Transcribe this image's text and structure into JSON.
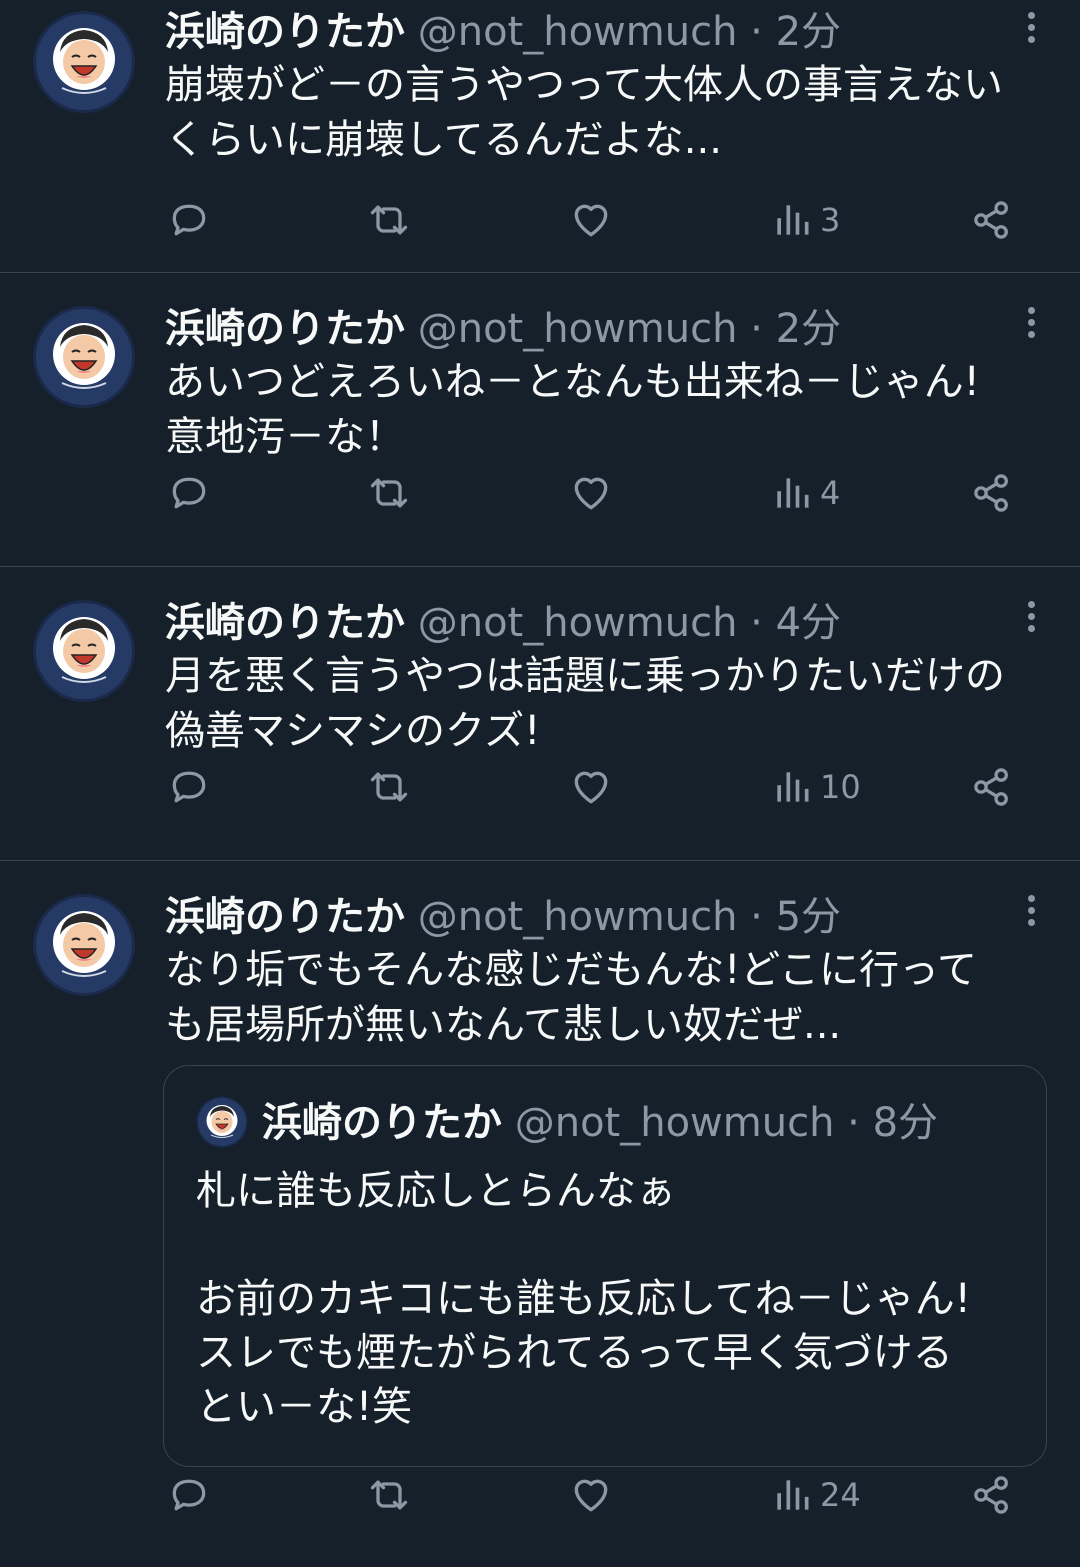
{
  "tweets": [
    {
      "name": "浜崎のりたか",
      "handle": "@not_howmuch · 2分",
      "text": "崩壊がど－の言うやつって大体人の事言えない\nくらいに崩壊してるんだよな...",
      "views": "3"
    },
    {
      "name": "浜崎のりたか",
      "handle": "@not_howmuch · 2分",
      "text": "あいつどえろいね－となんも出来ね－じゃん!\n意地汚－な！",
      "views": "4"
    },
    {
      "name": "浜崎のりたか",
      "handle": "@not_howmuch · 4分",
      "text": "月を悪く言うやつは話題に乗っかりたいだけの\n偽善マシマシのクズ!",
      "views": "10"
    },
    {
      "name": "浜崎のりたか",
      "handle": "@not_howmuch · 5分",
      "text": "なり垢でもそんな感じだもんな!どこに行って\nも居場所が無いなんて悲しい奴だぜ...",
      "views": "24",
      "quote": {
        "name": "浜崎のりたか",
        "handle": "@not_howmuch · 8分",
        "text": "札に誰も反応しとらんなぁ\n\nお前のカキコにも誰も反応してね－じゃん!\nスレでも煙たがられてるって早く気づける\nとい－な!笑"
      }
    }
  ],
  "icons": {
    "reply": "reply-icon",
    "retweet": "retweet-icon",
    "like": "heart-icon",
    "views": "views-icon",
    "share": "share-icon",
    "more": "more-vertical-icon"
  },
  "colors": {
    "background": "#15202b",
    "text": "#f7f9f9",
    "muted": "#8b98a5",
    "border": "#38444d"
  }
}
